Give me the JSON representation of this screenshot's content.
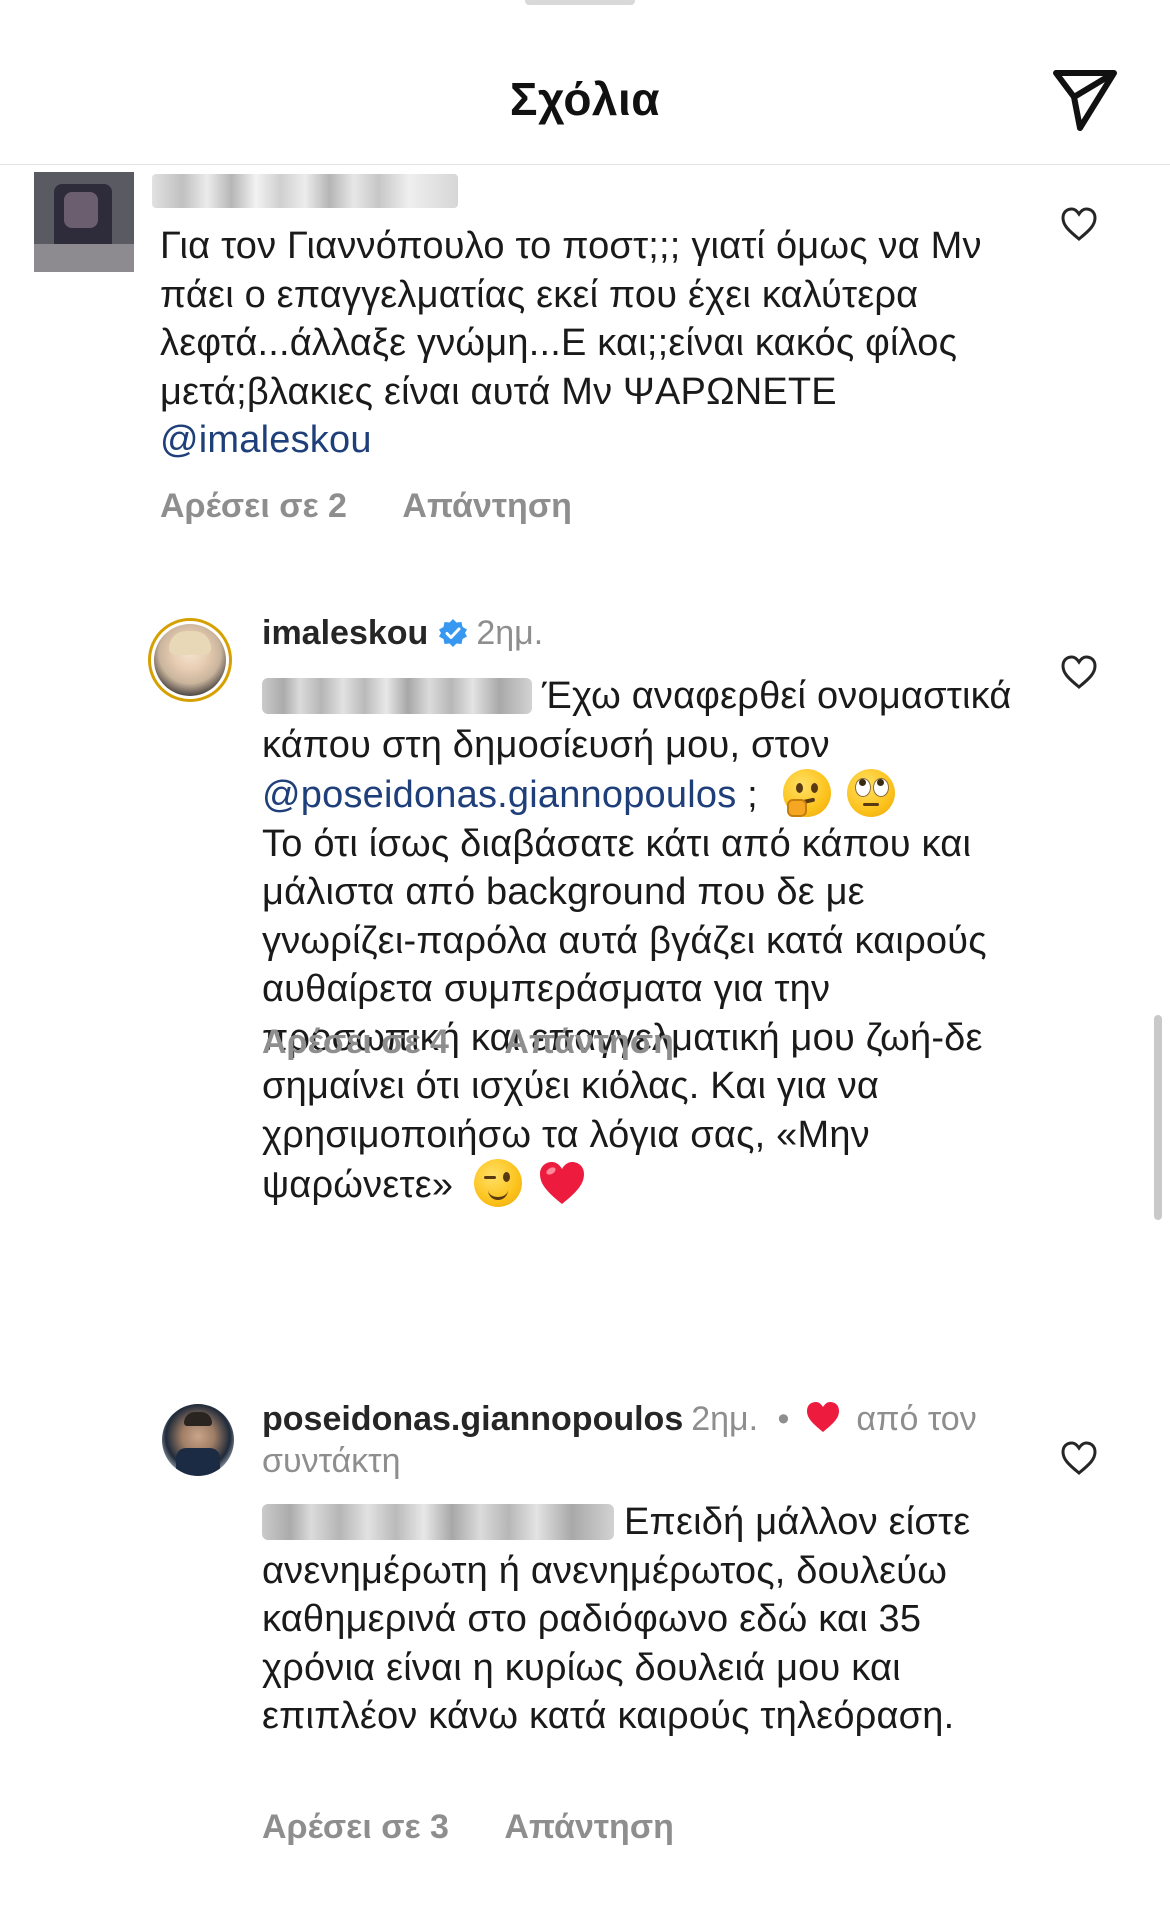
{
  "header": {
    "title": "Σχόλια"
  },
  "comments": [
    {
      "text": "Για τον Γιαννόπουλο το ποστ;;; γιατί όμως να Μν πάει ο επαγγελματίας εκεί που έχει καλύτερα λεφτά...άλλαξε γνώμη...Ε και;;είναι κακός φίλος μετά;βλακιες είναι αυτά Μν ΨΑΡΩΝΕΤΕ ",
      "mention": "@imaleskou",
      "likes": "Αρέσει σε 2",
      "reply": "Απάντηση"
    },
    {
      "username": "imaleskou",
      "time": "2ημ.",
      "text_1": "Έχω αναφερθεί ονομαστικά κάπου στη δημοσίευσή μου, στον",
      "mention": "@poseidonas.giannopoulos",
      "text_2": " ;",
      "text_3": "Το ότι ίσως διαβάσατε κάτι από κάπου και μάλιστα από background που δε με γνωρίζει-παρόλα αυτά βγάζει κατά καιρούς αυθαίρετα συμπεράσματα για την προσωπική και επαγγελματική μου ζωή-δε σημαίνει ότι ισχύει κιόλας. Και για να χρησιμοποιήσω τα λόγια σας, «Μην ψαρώνετε»",
      "likes": "Αρέσει σε 4",
      "reply": "Απάντηση",
      "emojis": [
        "thinking-face",
        "eye-roll-face",
        "winking-face",
        "red-heart"
      ]
    },
    {
      "username": "poseidonas.giannopoulos",
      "time": "2ημ.",
      "dot": "•",
      "liked_by_author": "από τον συντάκτη",
      "text": "Επειδή μάλλον είστε ανενημέρωτη ή ανενημέρωτος, δουλεύω καθημερινά στο ραδιόφωνο εδώ και 35 χρόνια είναι η κυρίως δουλειά μου και επιπλέον κάνω κατά καιρούς τηλεόραση.",
      "likes": "Αρέσει σε 3",
      "reply": "Απάντηση"
    }
  ],
  "colors": {
    "verified": "#3897f0",
    "heart_red": "#ed1c3f",
    "mention": "#1f3f7a",
    "meta_gray": "#8e8e8e"
  }
}
